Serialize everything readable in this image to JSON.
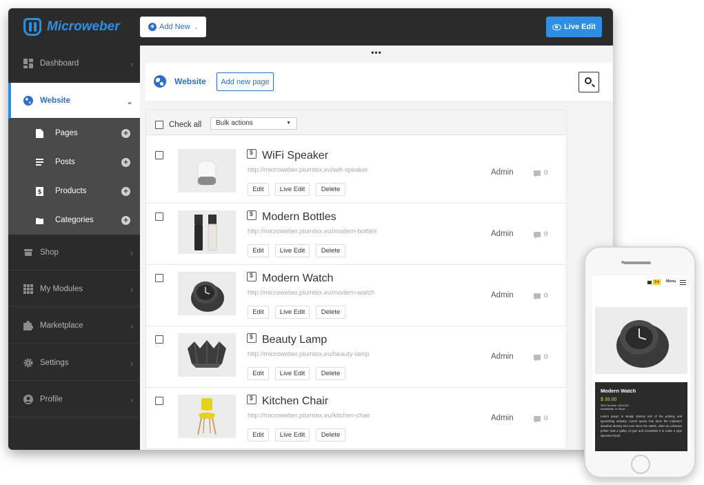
{
  "app": {
    "logo_text": "Microweber",
    "add_new_label": "Add New",
    "live_edit_label": "Live Edit",
    "accent_color": "#2d8ee3"
  },
  "sidebar": {
    "items": [
      {
        "label": "Dashboard",
        "icon": "dashboard-icon"
      },
      {
        "label": "Website",
        "icon": "globe-icon",
        "active": true
      },
      {
        "label": "Shop",
        "icon": "store-icon"
      },
      {
        "label": "My Modules",
        "icon": "grid-icon"
      },
      {
        "label": "Marketplace",
        "icon": "puzzle-icon"
      },
      {
        "label": "Settings",
        "icon": "gear-icon"
      },
      {
        "label": "Profile",
        "icon": "user-icon"
      }
    ],
    "subitems": [
      {
        "label": "Pages",
        "icon": "page-icon"
      },
      {
        "label": "Posts",
        "icon": "post-icon"
      },
      {
        "label": "Products",
        "icon": "product-icon"
      },
      {
        "label": "Categories",
        "icon": "folder-icon"
      }
    ]
  },
  "main": {
    "dots": "•••",
    "page_title": "Website",
    "add_page_label": "Add new page",
    "check_all_label": "Check all",
    "bulk_actions_label": "Bulk actions",
    "row_buttons": {
      "edit": "Edit",
      "live_edit": "Live Edit",
      "delete": "Delete"
    },
    "rows": [
      {
        "title": "WiFi Speaker",
        "url": "http://microweber.plumtex.eu/wifi-speaker",
        "author": "Admin",
        "comments": "0"
      },
      {
        "title": "Modern Bottles",
        "url": "http://microweber.plumtex.eu/modern-bottles",
        "author": "Admin",
        "comments": "0"
      },
      {
        "title": "Modern Watch",
        "url": "http://microweber.plumtex.eu/modern-watch",
        "author": "Admin",
        "comments": "0"
      },
      {
        "title": "Beauty Lamp",
        "url": "http://microweber.plumtex.eu/beauty-lamp",
        "author": "Admin",
        "comments": "0"
      },
      {
        "title": "Kitchen Chair",
        "url": "http://microweber.plumtex.eu/kitchen-chair",
        "author": "Admin",
        "comments": "0"
      }
    ]
  },
  "phone": {
    "badge": "3 ▾",
    "menu_label": "Menu",
    "product_title": "Modern Watch",
    "price": "$ 39.00",
    "sku": "SKU Number: #021321",
    "availability": "Availability: In Stock",
    "description": "Lorem Ipsum is simply dummy text of the printing and typesetting industry. Lorem Ipsum has been the industry's standard dummy text ever since the 1500s, when an unknown printer took a galley of type and scrambled it to make a type specimen book."
  }
}
